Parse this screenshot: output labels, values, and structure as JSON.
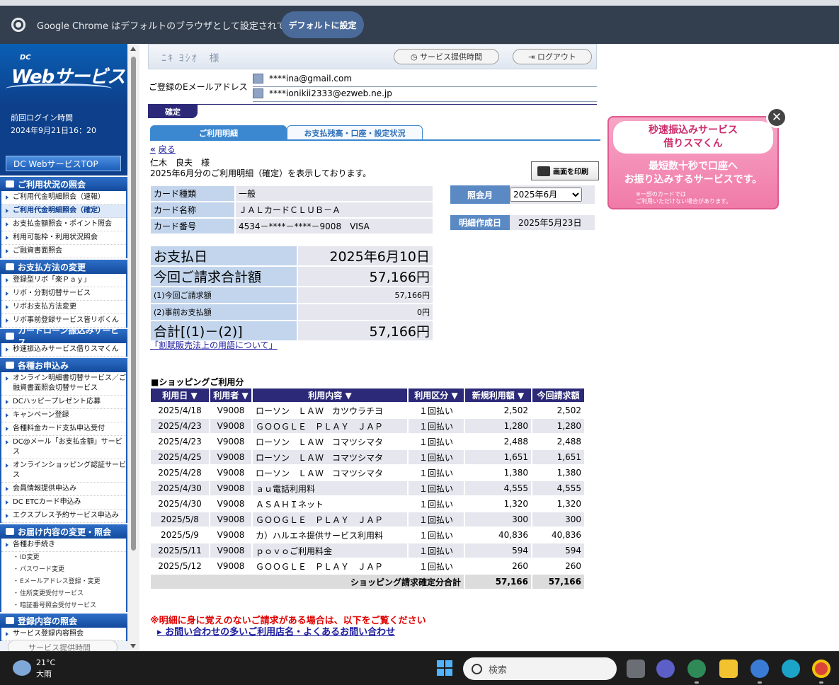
{
  "chrome_bar": {
    "message": "Google Chrome はデフォルトのブラウザとして設定されていません",
    "button": "デフォルトに設定"
  },
  "sidebar": {
    "logo_dc": "DC",
    "logo_text": "Webサービス",
    "last_login_label": "前回ログイン時間",
    "last_login_value": "2024年9月21日16：20",
    "top_button": "DC WebサービスTOP",
    "sections": [
      {
        "title": "ご利用状況の照会",
        "items": [
          "ご利用代金明細照会（速報）",
          "ご利用代金明細照会（確定）",
          "お支払金額照会・ポイント照会",
          "利用可能枠・利用状況照会",
          "ご融資書面照会"
        ]
      },
      {
        "title": "お支払方法の変更",
        "items": [
          "登録型リボ「楽Ｐａｙ」",
          "リボ・分割切替サービス",
          "リボお支払方法変更",
          "リボ事前登録サービス皆リボくん"
        ]
      },
      {
        "title": "カードローン振込みサービス",
        "items": [
          "秒速振込みサービス借りスマくん"
        ]
      },
      {
        "title": "各種お申込み",
        "items": [
          "オンライン明細書切替サービス／ご融資書面照会切替サービス",
          "DCハッピープレゼント応募",
          "キャンペーン登録",
          "各種料金カード支払申込受付",
          "DC@メール「お支払金額」サービス",
          "オンラインショッピング認証サービス",
          "会員情報提供申込み",
          "DC ETCカード申込み",
          "エクスプレス予約サービス申込み"
        ]
      },
      {
        "title": "お届け内容の変更・照会",
        "items": [
          "各種お手続き"
        ],
        "subitems": [
          "ID変更",
          "パスワード変更",
          "Eメールアドレス登録・変更",
          "住所変更受付サービス",
          "暗証番号照会受付サービス"
        ]
      },
      {
        "title": "登録内容の照会",
        "items": [
          "サービス登録内容照会"
        ]
      }
    ],
    "bottom_button": "サービス提供時間"
  },
  "header": {
    "name": "ﾆｷ ﾖｼｵ　様",
    "service_time_button": "サービス提供時間",
    "logout_button": "ログアウト"
  },
  "email": {
    "label": "ご登録のEメールアドレス",
    "pc": "****ina@gmail.com",
    "mobile": "****ionikii2333@ezweb.ne.jp"
  },
  "status_tag": "確定",
  "tabs": [
    "ご利用明細",
    "お支払残高・口座・設定状況"
  ],
  "back_link": "戻る",
  "customer": {
    "name": "仁木　良夫　様",
    "message": "2025年6月分のご利用明細（確定）を表示しております。"
  },
  "print_button": "画面を印刷",
  "card_info": [
    {
      "label": "カード種類",
      "value": "一般"
    },
    {
      "label": "カード名称",
      "value": "ＪＡＬカードＣＬＵＢ－Ａ"
    },
    {
      "label": "カード番号",
      "value": "4534－****－****－9008　VISA"
    }
  ],
  "period": {
    "label": "照会月",
    "selected": "2025年6月",
    "created_label": "明細作成日",
    "created_value": "2025年5月23日"
  },
  "payment_summary": [
    {
      "label": "お支払日",
      "value": "2025年6月10日",
      "size": "big"
    },
    {
      "label": "今回ご請求合計額",
      "value": "57,166円",
      "size": "big"
    },
    {
      "label": "(1)今回ご請求額",
      "value": "57,166円",
      "size": "sm"
    },
    {
      "label": "(2)事前お支払額",
      "value": "0円",
      "size": "sm"
    },
    {
      "label": "合計[(1)－(2)]",
      "value": "57,166円",
      "size": "big"
    }
  ],
  "terms_link": "「割賦販売法上の用語について」",
  "shopping": {
    "title": "■ショッピングご利用分",
    "headers": [
      "利用日 ▼",
      "利用者 ▼",
      "利用内容 ▼",
      "利用区分 ▼",
      "新規利用額 ▼",
      "今回請求額"
    ],
    "rows": [
      [
        "2025/4/18",
        "V9008",
        "ローソン　ＬＡＷ　カツウラチヨ",
        "１回払い",
        "2,502",
        "2,502"
      ],
      [
        "2025/4/23",
        "V9008",
        "ＧＯＯＧＬＥ　ＰＬＡＹ　ＪＡＰ",
        "１回払い",
        "1,280",
        "1,280"
      ],
      [
        "2025/4/23",
        "V9008",
        "ローソン　ＬＡＷ　コマツシマタ",
        "１回払い",
        "2,488",
        "2,488"
      ],
      [
        "2025/4/25",
        "V9008",
        "ローソン　ＬＡＷ　コマツシマタ",
        "１回払い",
        "1,651",
        "1,651"
      ],
      [
        "2025/4/28",
        "V9008",
        "ローソン　ＬＡＷ　コマツシマタ",
        "１回払い",
        "1,380",
        "1,380"
      ],
      [
        "2025/4/30",
        "V9008",
        "ａｕ電話利用料",
        "１回払い",
        "4,555",
        "4,555"
      ],
      [
        "2025/4/30",
        "V9008",
        "ＡＳＡＨＩネット",
        "１回払い",
        "1,320",
        "1,320"
      ],
      [
        "2025/5/8",
        "V9008",
        "ＧＯＯＧＬＥ　ＰＬＡＹ　ＪＡＰ",
        "１回払い",
        "300",
        "300"
      ],
      [
        "2025/5/9",
        "V9008",
        "カ）ハルエネ提供サービス利用料",
        "１回払い",
        "40,836",
        "40,836"
      ],
      [
        "2025/5/11",
        "V9008",
        "ｐｏｖｏご利用料金",
        "１回払い",
        "594",
        "594"
      ],
      [
        "2025/5/12",
        "V9008",
        "ＧＯＯＧＬＥ　ＰＬＡＹ　ＪＡＰ",
        "１回払い",
        "260",
        "260"
      ]
    ],
    "total_label": "ショッピング請求確定分合計",
    "total_new": "57,166",
    "total_billed": "57,166"
  },
  "warning": "※明細に身に覚えのないご請求がある場合は、以下をご覧ください",
  "faq_link": "お問い合わせの多いご利用店名・よくあるお問い合わせ",
  "ad": {
    "title_line1": "秒速振込みサービス",
    "title_line2": "借りスマくん",
    "text_line1": "最短数十秒で口座へ",
    "text_line2": "お振り込みするサービスです。",
    "note_line1": "※一部のカードでは",
    "note_line2": "ご利用いただけない場合があります。",
    "close": "✕"
  },
  "taskbar": {
    "temperature": "21°C",
    "weather": "大雨",
    "search_placeholder": "検索"
  }
}
